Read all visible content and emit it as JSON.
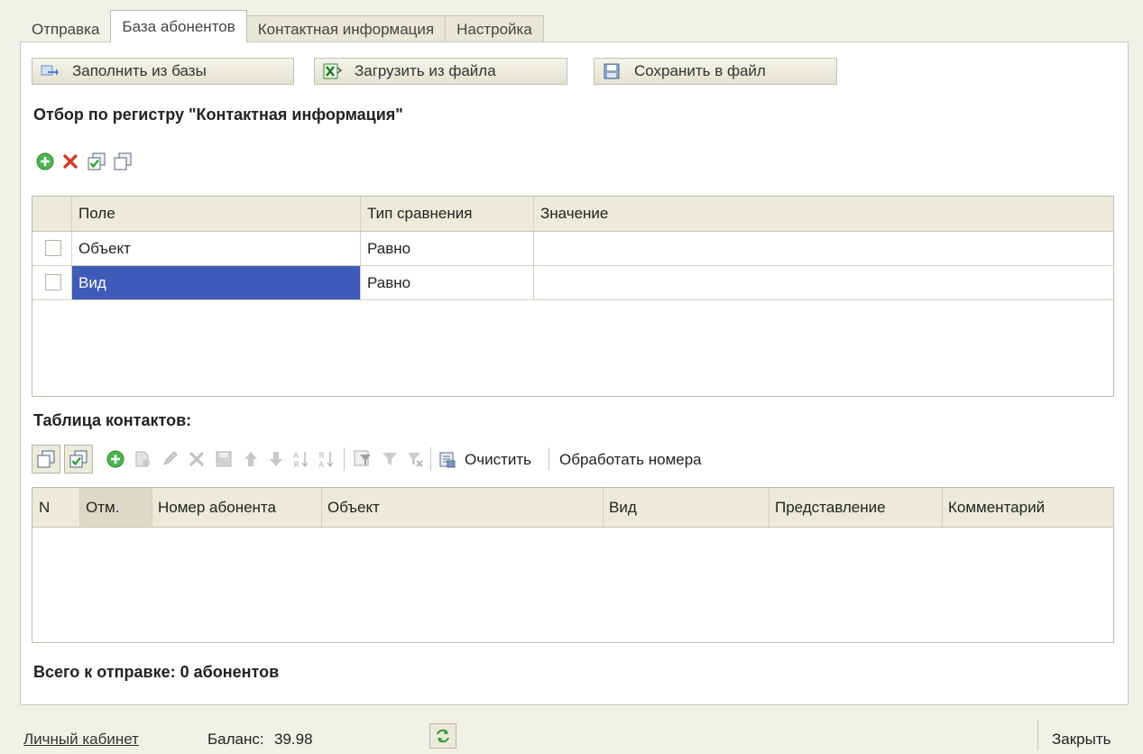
{
  "tabs": [
    {
      "label": "Отправка"
    },
    {
      "label": "База абонентов"
    },
    {
      "label": "Контактная информация"
    },
    {
      "label": "Настройка"
    }
  ],
  "toolbar": {
    "fill_label": "Заполнить из базы",
    "load_label": "Загрузить из файла",
    "save_label": "Сохранить в файл"
  },
  "filter": {
    "title": "Отбор по регистру \"Контактная информация\"",
    "columns": {
      "field": "Поле",
      "compare": "Тип сравнения",
      "value": "Значение"
    },
    "rows": [
      {
        "field": "Объект",
        "compare": "Равно",
        "value": ""
      },
      {
        "field": "Вид",
        "compare": "Равно",
        "value": ""
      }
    ]
  },
  "contacts": {
    "title": "Таблица контактов:",
    "clear_label": "Очистить",
    "process_label": "Обработать номера",
    "columns": {
      "n": "N",
      "mark": "Отм.",
      "number": "Номер абонента",
      "object": "Объект",
      "kind": "Вид",
      "presentation": "Представление",
      "comment": "Комментарий"
    }
  },
  "total_text": "Всего к отправке: 0 абонентов",
  "status": {
    "cabinet_label": "Личный кабинет",
    "balance_label": "Баланс:",
    "balance_value": "39.98",
    "close_label": "Закрыть"
  },
  "colors": {
    "selected_row": "#3f5ab8",
    "add_green": "#3aa13a",
    "delete_red": "#d63a2a"
  }
}
